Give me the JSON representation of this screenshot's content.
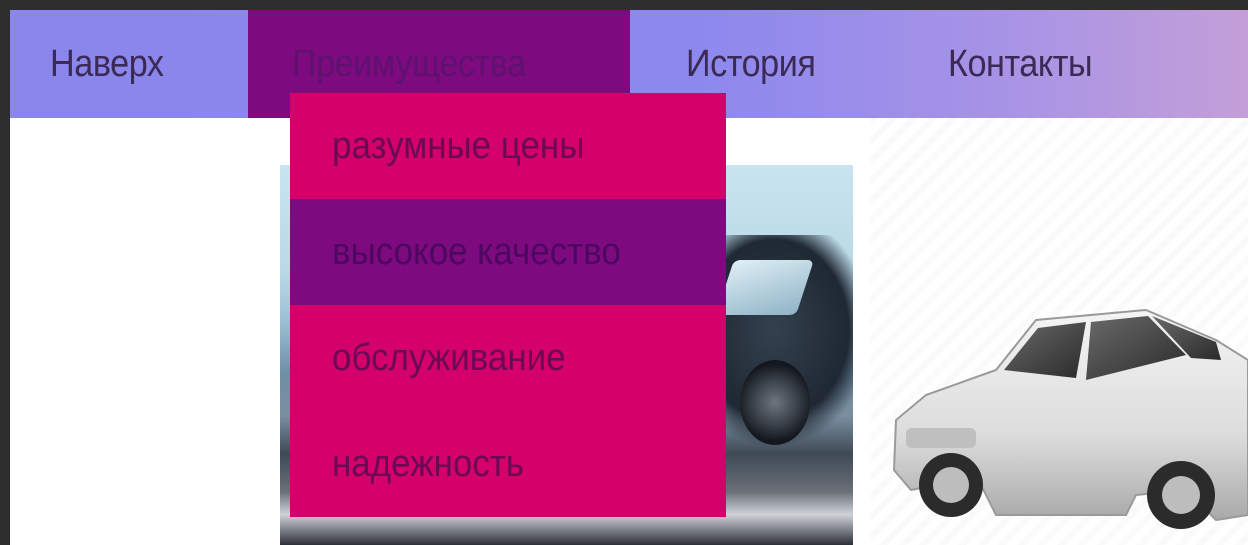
{
  "nav": {
    "items": [
      {
        "label": "Наверх"
      },
      {
        "label": "Преимущества"
      },
      {
        "label": "История"
      },
      {
        "label": "Контакты"
      }
    ]
  },
  "dropdown": {
    "items": [
      {
        "label": "разумные цены"
      },
      {
        "label": "высокое качество"
      },
      {
        "label": "обслуживание"
      },
      {
        "label": "надежность"
      }
    ]
  },
  "colors": {
    "navbar": "#8a86ec",
    "active_nav": "#7d0a7f",
    "dropdown_bg": "#d5016a",
    "dropdown_hover": "#7d0a7f"
  },
  "images": {
    "left_photo": "car-on-road-photo",
    "right_photo": "white-sedan-photo"
  }
}
